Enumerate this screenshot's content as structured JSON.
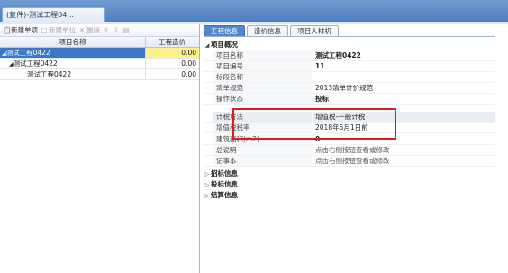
{
  "document_tab": {
    "label": "(复件)-测试工程04..."
  },
  "toolbar": {
    "buttons": [
      {
        "label": "新建单项",
        "icon": "new-item-icon",
        "enabled": true
      },
      {
        "label": "新建单位",
        "icon": "new-unit-icon",
        "enabled": false
      },
      {
        "label": "删除",
        "icon": "delete-icon",
        "enabled": false
      },
      {
        "label": "",
        "icon": "arrow-up-icon",
        "enabled": false
      },
      {
        "label": "",
        "icon": "arrow-down-icon",
        "enabled": false
      },
      {
        "label": "",
        "icon": "document-icon",
        "enabled": false
      }
    ]
  },
  "tree_grid": {
    "columns": [
      "项目名称",
      "工程造价"
    ],
    "rows": [
      {
        "name": "测试工程0422",
        "value": "0.00",
        "expanded": true,
        "selected": true
      },
      {
        "name": "测试工程0422",
        "value": "0.00",
        "expanded": true,
        "selected": false
      },
      {
        "name": "测试工程0422",
        "value": "0.00",
        "expanded": false,
        "selected": false
      }
    ]
  },
  "right_tabs": [
    {
      "label": "工程信息",
      "active": true
    },
    {
      "label": "造价信息",
      "active": false
    },
    {
      "label": "项目人材机",
      "active": false
    }
  ],
  "project_overview": {
    "title": "项目概况",
    "fields": [
      {
        "key": "项目名称",
        "value": "测试工程0422",
        "bold": true
      },
      {
        "key": "项目编号",
        "value": "11",
        "bold": true
      },
      {
        "key": "标段名称",
        "value": ""
      },
      {
        "key": "清单规范",
        "value": "2013清单计价规范"
      },
      {
        "key": "操作状态",
        "value": "投标",
        "bold": true
      },
      {
        "key": "计税方法",
        "value": "增值税-一般计税",
        "shaded": true
      },
      {
        "key": "增值税税率",
        "value": "2018年5月1日前"
      },
      {
        "key": "建筑面积(m2)",
        "value": "0",
        "bold": true
      },
      {
        "key": "总说明",
        "value": "点击右侧按钮查看或修改",
        "hint": true
      },
      {
        "key": "记事本",
        "value": "点击右侧按钮查看或修改",
        "hint": true
      }
    ]
  },
  "collapsed_sections": [
    "招标信息",
    "投标信息",
    "结算信息"
  ],
  "colors": {
    "title_bar": "#4d7fc0",
    "active_tab": "#4f86cf",
    "selected_row": "#3c76c7",
    "value_highlight": "#fbf08a",
    "annotation_box": "#d81e1e"
  }
}
